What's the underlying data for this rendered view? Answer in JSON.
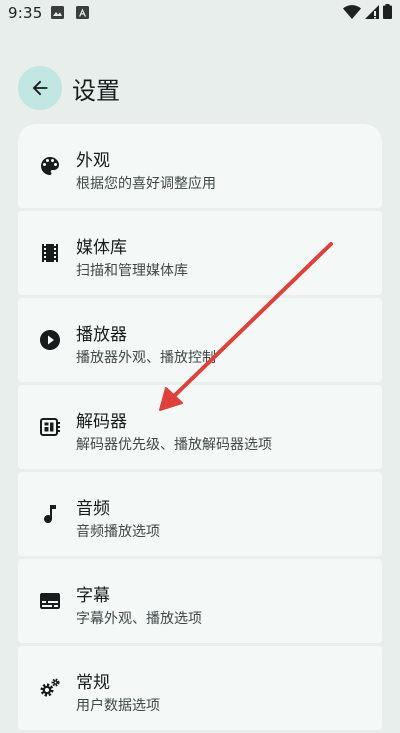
{
  "status_bar": {
    "time": "9:35",
    "icons": [
      "image-icon",
      "text-a-icon",
      "wifi-icon",
      "signal-icon",
      "battery-icon"
    ]
  },
  "header": {
    "title": "设置",
    "back_icon": "arrow-back-icon"
  },
  "settings": [
    {
      "title": "外观",
      "subtitle": "根据您的喜好调整应用",
      "icon": "palette-icon"
    },
    {
      "title": "媒体库",
      "subtitle": "扫描和管理媒体库",
      "icon": "film-strip-icon"
    },
    {
      "title": "播放器",
      "subtitle": "播放器外观、播放控制",
      "icon": "play-circle-icon"
    },
    {
      "title": "解码器",
      "subtitle": "解码器优先级、播放解码器选项",
      "icon": "decoder-chip-icon"
    },
    {
      "title": "音频",
      "subtitle": "音频播放选项",
      "icon": "music-note-icon"
    },
    {
      "title": "字幕",
      "subtitle": "字幕外观、播放选项",
      "icon": "subtitles-icon"
    },
    {
      "title": "常规",
      "subtitle": "用户数据选项",
      "icon": "gears-icon"
    }
  ],
  "annotation": {
    "arrow_color": "#e0403a",
    "arrow_target": "解码器"
  },
  "colors": {
    "accent": "#c2e6e1",
    "background": "#e8eeec",
    "card": "#f4f9f8"
  }
}
